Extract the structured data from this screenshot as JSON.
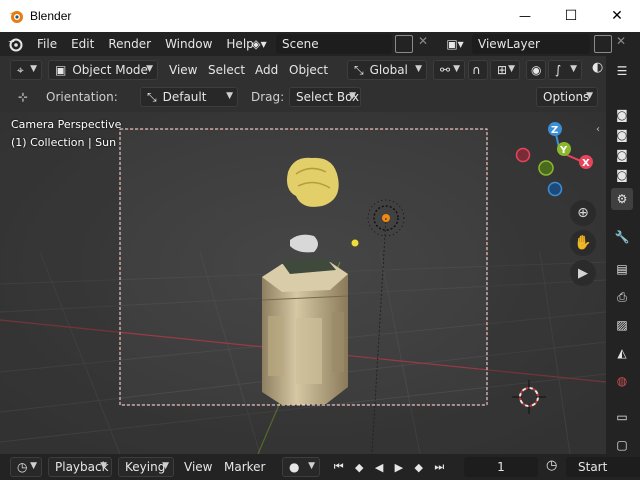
{
  "window": {
    "title": "Blender",
    "minimize": "—",
    "maximize": "☐",
    "close": "✕"
  },
  "menu": {
    "items": [
      "File",
      "Edit",
      "Render",
      "Window",
      "Help"
    ]
  },
  "scene": {
    "name": "Scene",
    "view_layer": "ViewLayer"
  },
  "header": {
    "mode": "Object Mode",
    "menus": [
      "View",
      "Select",
      "Add",
      "Object"
    ],
    "transform": "Global"
  },
  "tool": {
    "orientation_label": "Orientation:",
    "orientation_value": "Default",
    "drag_label": "Drag:",
    "drag_value": "Select Box",
    "options": "Options"
  },
  "viewport": {
    "camera_label": "Camera Perspective",
    "collection_label": "(1) Collection | Sun"
  },
  "gizmo": {
    "z": "Z",
    "y": "Y",
    "x": "X"
  },
  "timeline": {
    "playback": "Playback",
    "keying": "Keying",
    "view": "View",
    "marker": "Marker",
    "frame": "1",
    "start": "Start"
  },
  "colors": {
    "accent": "#e87d0d",
    "x_axis": "#e8455c",
    "y_axis": "#8bb82f",
    "z_axis": "#3b8fd6"
  }
}
